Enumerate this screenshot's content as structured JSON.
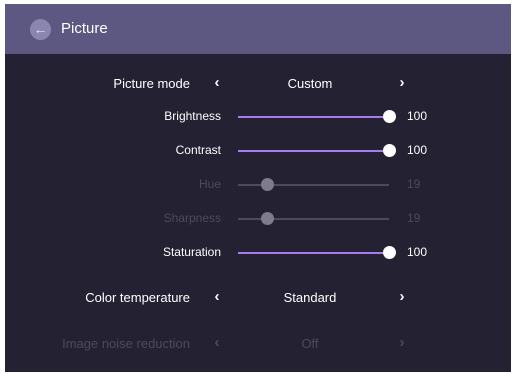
{
  "header": {
    "title": "Picture",
    "back_icon": "←"
  },
  "picture_mode": {
    "label": "Picture mode",
    "value": "Custom",
    "prev": "‹",
    "next": "›"
  },
  "brightness": {
    "label": "Brightness",
    "value": "100",
    "level": 1.0
  },
  "contrast": {
    "label": "Contrast",
    "value": "100",
    "level": 1.0
  },
  "hue": {
    "label": "Hue",
    "value": "19",
    "level": 0.19,
    "enabled": false
  },
  "sharpness": {
    "label": "Sharpness",
    "value": "19",
    "level": 0.19,
    "enabled": false
  },
  "saturation": {
    "label": "Staturation",
    "value": "100",
    "level": 1.0
  },
  "color_temperature": {
    "label": "Color temperature",
    "value": "Standard",
    "prev": "‹",
    "next": "›"
  },
  "noise_reduction": {
    "label": "Image noise reduction",
    "value": "Off",
    "prev": "‹",
    "next": "›",
    "enabled": false
  },
  "colors": {
    "accent": "#a77cf1",
    "header": "#5c5882",
    "background": "#232132"
  }
}
